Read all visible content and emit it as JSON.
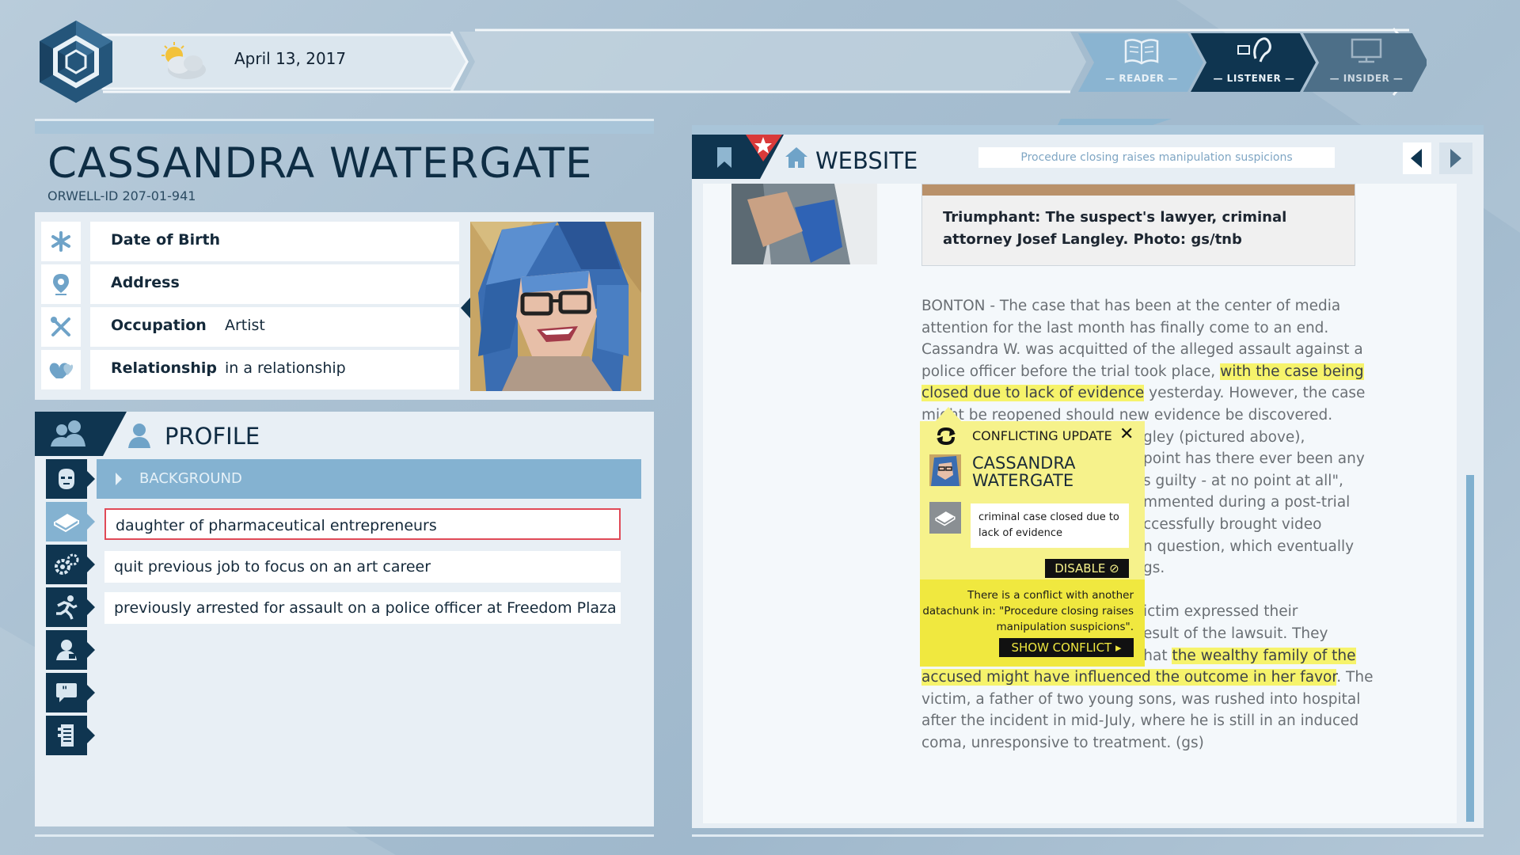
{
  "header": {
    "date": "April 13, 2017",
    "modes": [
      {
        "label": "— READER —",
        "icon": "book-icon"
      },
      {
        "label": "— LISTENER —",
        "icon": "ear-icon"
      },
      {
        "label": "— INSIDER —",
        "icon": "monitor-icon"
      }
    ]
  },
  "person": {
    "name": "CASSANDRA WATERGATE",
    "orwell_id": "ORWELL-ID  207-01-941",
    "fields": [
      {
        "key": "Date of Birth",
        "value": "",
        "icon": "asterisk-icon"
      },
      {
        "key": "Address",
        "value": "",
        "icon": "location-pin-icon"
      },
      {
        "key": "Occupation",
        "value": "Artist",
        "icon": "tools-icon"
      },
      {
        "key": "Relationship",
        "value": "in a relationship",
        "icon": "hearts-icon"
      }
    ]
  },
  "profile": {
    "title": "PROFILE",
    "section": "BACKGROUND",
    "chunks": [
      "daughter of pharmaceutical entrepreneurs",
      "quit previous job to focus on an art career",
      "previously arrested for assault on a police officer at Freedom Plaza"
    ]
  },
  "website": {
    "title": "WEBSITE",
    "search_value": "Procedure closing raises manipulation suspicions",
    "caption": "Triumphant: The suspect's lawyer, criminal attorney Josef Langley. Photo: gs/tnb",
    "lines": [
      {
        "pre": "BONTON - The case that has been at the center of media",
        "hl": "",
        "post": ""
      },
      {
        "pre": "attention for the last month has finally come to an end.",
        "hl": "",
        "post": ""
      },
      {
        "pre": "Cassandra W. was acquitted of the alleged assault against a",
        "hl": "",
        "post": ""
      },
      {
        "pre": "police officer before the trial took place, ",
        "hl": "with the case being",
        "post": ""
      },
      {
        "pre": "",
        "hl": "closed due to lack of evidence",
        "post": " yesterday. However, the case"
      },
      {
        "pre": "might be reopened should new evidence be discovered.",
        "hl": "",
        "post": ""
      },
      {
        "pre": "",
        "hl": "",
        "post": "gley (pictured above),"
      },
      {
        "pre": "",
        "hl": "",
        "post": "point has there ever been any"
      },
      {
        "pre": "",
        "hl": "",
        "post": "s guilty - at no point at all\","
      },
      {
        "pre": "",
        "hl": "",
        "post": "mmented during a post-trial"
      },
      {
        "pre": "",
        "hl": "",
        "post": "ccessfully brought video"
      },
      {
        "pre": "",
        "hl": "",
        "post": "n question, which eventually"
      },
      {
        "pre": "",
        "hl": "",
        "post": "gs."
      },
      {
        "pre": "",
        "hl": "",
        "post": ""
      },
      {
        "pre": "",
        "hl": "",
        "post": "ictim expressed their"
      },
      {
        "pre": "",
        "hl": "",
        "post": "esult of the lawsuit. They"
      },
      {
        "pre": "openly voiced their concerns that ",
        "hl": "the wealthy family of the",
        "post": ""
      },
      {
        "pre": "",
        "hl": "accused might have influenced the outcome in her favor",
        "post": ". The"
      },
      {
        "pre": "victim, a father of two young sons, was rushed into hospital",
        "hl": "",
        "post": ""
      },
      {
        "pre": "after the incident in mid-July, where he is still in an induced",
        "hl": "",
        "post": ""
      },
      {
        "pre": "coma, unresponsive to treatment. (gs)",
        "hl": "",
        "post": ""
      }
    ]
  },
  "conflict": {
    "title": "CONFLICTING UPDATE",
    "close": "✕",
    "name_line1": "CASSANDRA",
    "name_line2": "WATERGATE",
    "chunk": "criminal case closed due to lack of evidence",
    "disable": "DISABLE ⊘",
    "message": "There is a conflict with another datachunk in: \"Procedure closing raises manipulation suspicions\".",
    "show": "SHOW CONFLICT ▸"
  },
  "colors": {
    "accent": "#0f3550",
    "highlight": "#f6f36b",
    "panel": "#e7eef4",
    "selected": "#e04a57"
  }
}
